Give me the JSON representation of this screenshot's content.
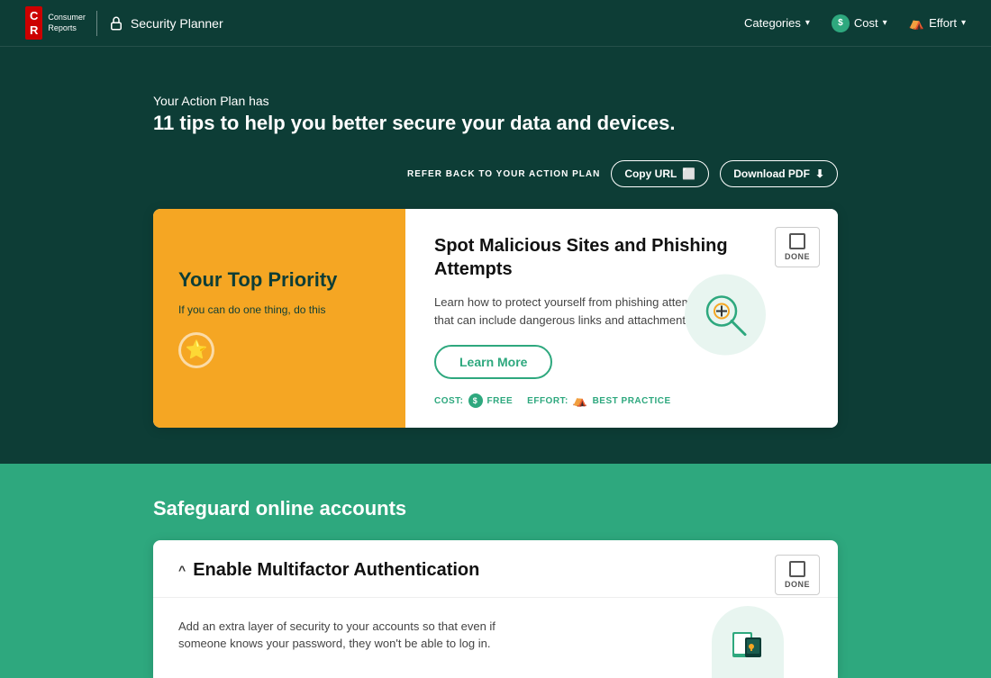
{
  "navbar": {
    "cr_label_line1": "Consumer",
    "cr_label_line2": "Reports",
    "brand": "Security Planner",
    "categories": "Categories",
    "cost": "Cost",
    "effort": "Effort"
  },
  "hero": {
    "subtitle": "Your Action Plan has",
    "title": "11 tips to help you better secure your data and devices.",
    "refer_label": "REFER BACK TO YOUR ACTION PLAN",
    "copy_url": "Copy URL",
    "download_pdf": "Download PDF"
  },
  "top_priority": {
    "section_label": "Your Top Priority",
    "section_desc": "If you can do one thing, do this",
    "card_title": "Spot Malicious Sites and Phishing Attempts",
    "card_desc": "Learn how to protect yourself from phishing attempts that can include dangerous links and attachments.",
    "learn_more": "Learn More",
    "done_label": "DONE",
    "cost_label": "FREE",
    "effort_label": "BEST PRACTICE",
    "cost_prefix": "COST:",
    "effort_prefix": "EFFORT:"
  },
  "safeguard": {
    "section_label": "Safeguard online accounts",
    "card_title": "Enable Multifactor Authentication",
    "card_desc": "Add an extra layer of security to your accounts so that even if someone knows your password, they won't be able to log in.",
    "done_label": "DONE"
  }
}
